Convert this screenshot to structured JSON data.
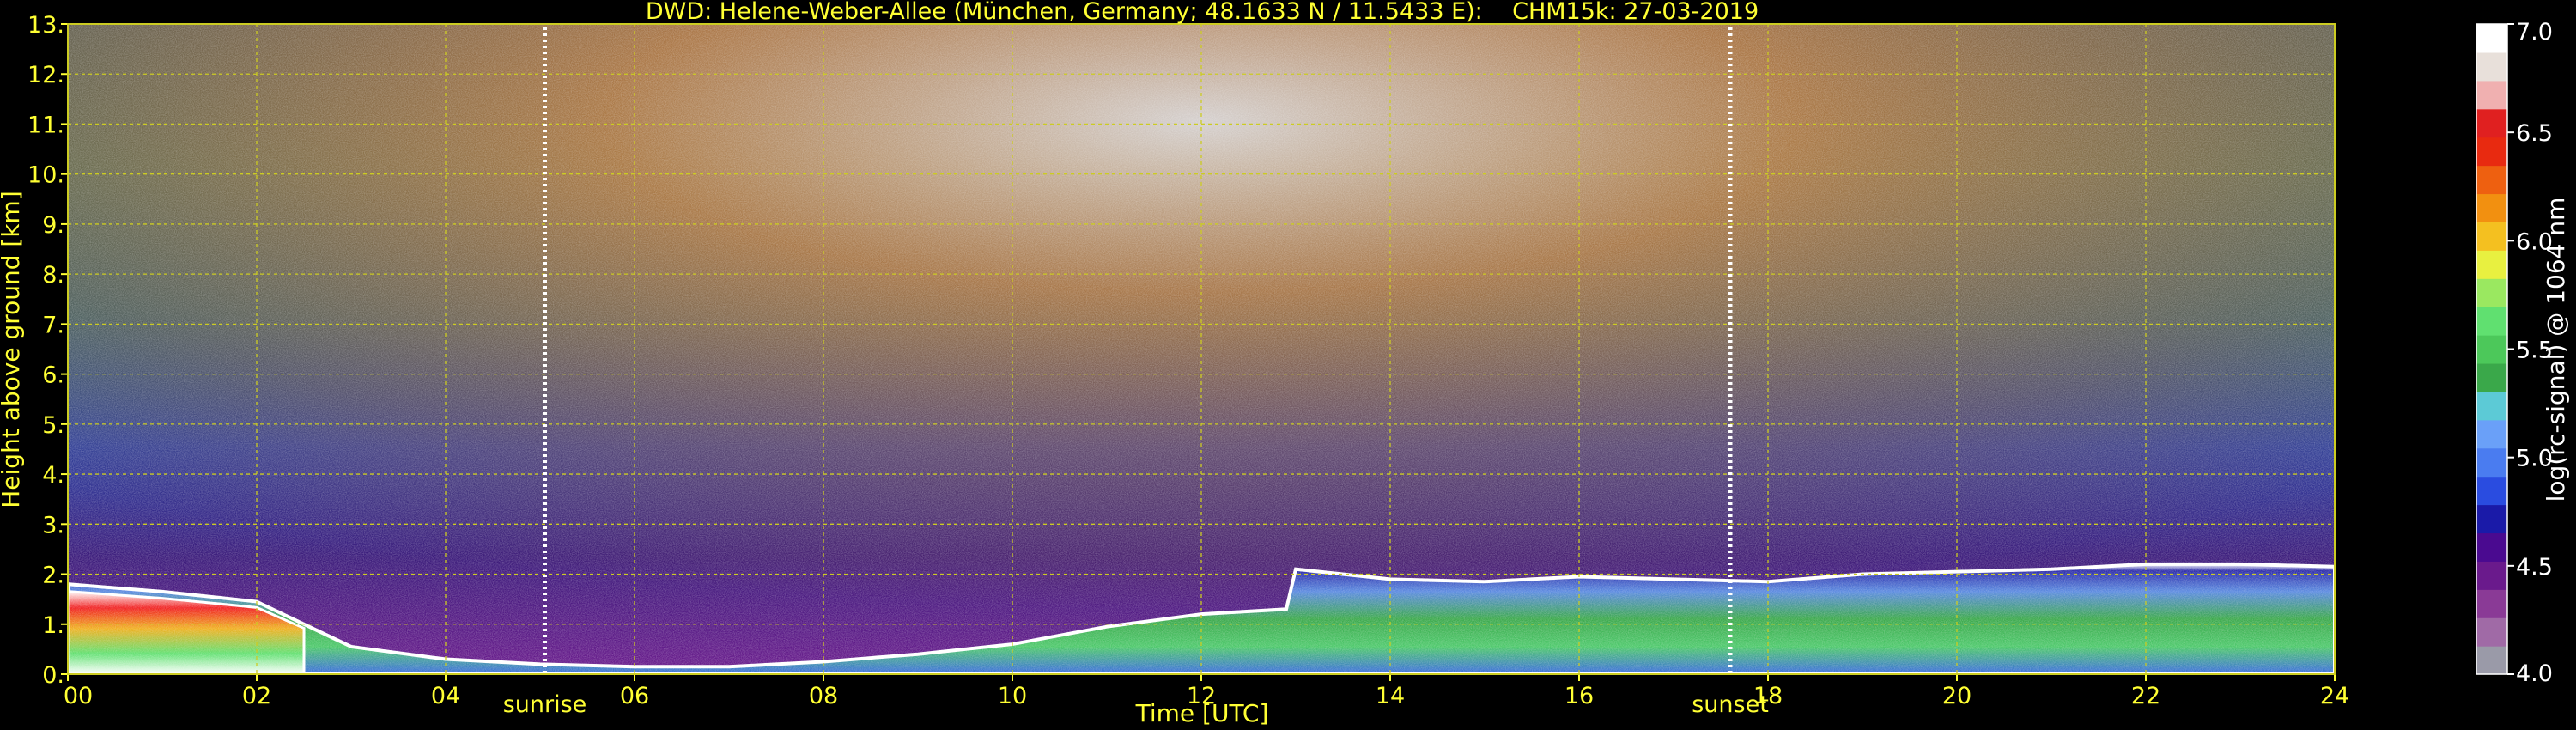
{
  "chart_data": {
    "type": "heatmap",
    "title": "DWD: Helene-Weber-Allee (München, Germany; 48.1633 N / 11.5433 E):    CHM15k: 27-03-2019",
    "xlabel": "Time [UTC]",
    "ylabel": "Height above ground [km]",
    "xlim": [
      0,
      24
    ],
    "ylim": [
      0,
      13
    ],
    "x_ticks": [
      "00",
      "02",
      "04",
      "06",
      "08",
      "10",
      "12",
      "14",
      "16",
      "18",
      "20",
      "22",
      "24"
    ],
    "y_ticks": [
      "0.",
      "1.",
      "2.",
      "3.",
      "4.",
      "5.",
      "6.",
      "7.",
      "8.",
      "9.",
      "10.",
      "11.",
      "12.",
      "13."
    ],
    "grid": true,
    "annotations": [
      {
        "text": "sunrise",
        "x": 5.05
      },
      {
        "text": "sunset",
        "x": 17.6
      }
    ],
    "colorbar": {
      "label": "log(rc-signal) @ 1064 nm",
      "range": [
        4.0,
        7.0
      ],
      "ticks": [
        "4.0",
        "4.5",
        "5.0",
        "5.5",
        "6.0",
        "6.5",
        "7.0"
      ]
    },
    "boundary_layer_top_km": [
      [
        0,
        1.8
      ],
      [
        1,
        1.65
      ],
      [
        2,
        1.45
      ],
      [
        2.5,
        1.0
      ],
      [
        3,
        0.55
      ],
      [
        4,
        0.3
      ],
      [
        5,
        0.2
      ],
      [
        6,
        0.15
      ],
      [
        7,
        0.15
      ],
      [
        8,
        0.25
      ],
      [
        9,
        0.4
      ],
      [
        10,
        0.6
      ],
      [
        11,
        0.95
      ],
      [
        12,
        1.2
      ],
      [
        12.9,
        1.3
      ],
      [
        13,
        2.1
      ],
      [
        14,
        1.9
      ],
      [
        15,
        1.85
      ],
      [
        16,
        1.95
      ],
      [
        17,
        1.9
      ],
      [
        18,
        1.85
      ],
      [
        19,
        2.0
      ],
      [
        20,
        2.05
      ],
      [
        21,
        2.1
      ],
      [
        22,
        2.2
      ],
      [
        23,
        2.2
      ],
      [
        24,
        2.15
      ]
    ]
  },
  "colors": {
    "text": "#ffff33",
    "grid": "#cccc22",
    "background": "#000000",
    "colorbar_steps": [
      "#9a9aa8",
      "#a06aa6",
      "#8a3a96",
      "#6a1a8c",
      "#4a0a90",
      "#1a1aa8",
      "#2a4ce0",
      "#4a7cf0",
      "#6aa0f8",
      "#5ccad6",
      "#3aa84a",
      "#4cc85a",
      "#60e070",
      "#9ae860",
      "#e8f040",
      "#f4c020",
      "#f29010",
      "#ee6010",
      "#e82a10",
      "#e02020",
      "#f0b0b0",
      "#e8e0da",
      "#ffffff"
    ]
  }
}
